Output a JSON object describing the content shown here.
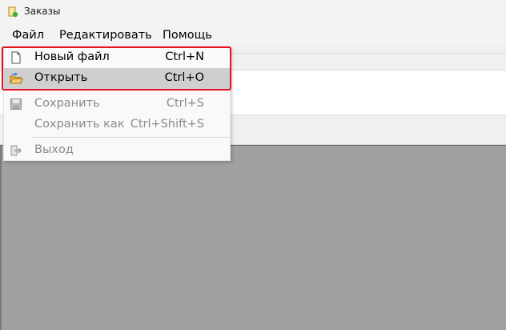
{
  "window": {
    "title": "Заказы",
    "icon": "app-icon"
  },
  "menubar": {
    "items": [
      {
        "label": "Файл"
      },
      {
        "label": "Редактировать"
      },
      {
        "label": "Помощь"
      }
    ]
  },
  "file_menu": {
    "items": [
      {
        "label": "Новый файл",
        "shortcut": "Ctrl+N",
        "icon": "new-file-icon",
        "enabled": true
      },
      {
        "label": "Открыть",
        "shortcut": "Ctrl+O",
        "icon": "open-folder-icon",
        "enabled": true,
        "hovered": true
      },
      {
        "label": "Сохранить",
        "shortcut": "Ctrl+S",
        "icon": "save-icon",
        "enabled": false
      },
      {
        "label": "Сохранить как",
        "shortcut": "Ctrl+Shift+S",
        "icon": "",
        "enabled": false
      },
      {
        "label": "Выход",
        "shortcut": "",
        "icon": "exit-icon",
        "enabled": false
      }
    ]
  },
  "colors": {
    "highlight_border": "#e8101c",
    "hover_background": "#cfcfcf",
    "workspace_background": "#a0a0a0",
    "disabled_text": "#8a8a8a"
  }
}
